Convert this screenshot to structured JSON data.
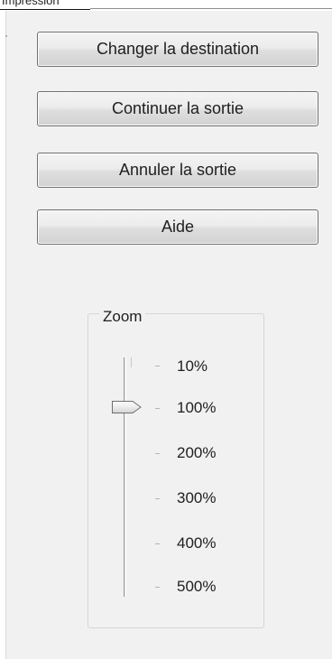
{
  "header": {
    "title_fragment": "Impression"
  },
  "actions": {
    "change_destination": "Changer la destination",
    "continue_output": "Continuer la sortie",
    "cancel_output": "Annuler la sortie",
    "help": "Aide"
  },
  "zoom": {
    "label": "Zoom",
    "levels": [
      "10%",
      "100%",
      "200%",
      "300%",
      "400%",
      "500%"
    ],
    "selected": "100%"
  }
}
